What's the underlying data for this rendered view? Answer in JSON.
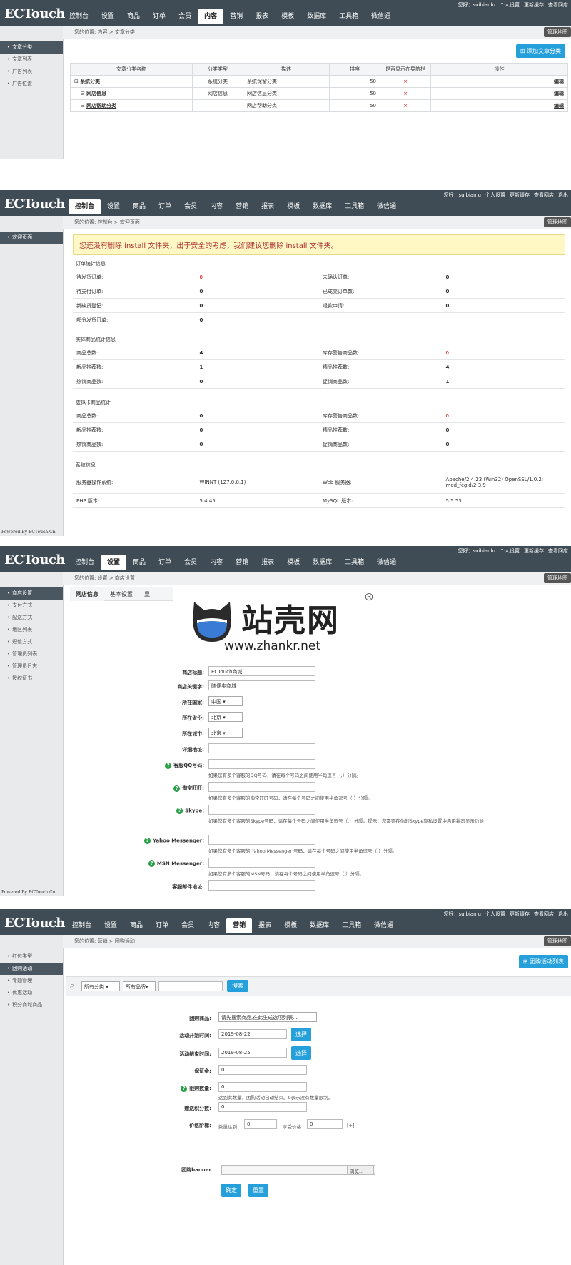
{
  "app": {
    "logo": "ECTouch",
    "user_links": [
      "您好：suibianlu",
      "个人设置",
      "更新缓存",
      "查看网店",
      "退出"
    ]
  },
  "nav": [
    "控制台",
    "设置",
    "商品",
    "订单",
    "会员",
    "内容",
    "营销",
    "报表",
    "模板",
    "数据库",
    "工具箱",
    "微信通"
  ],
  "mgmt_label": "管理地图",
  "powered": "Powered By ECTouch.Cn",
  "watermark": {
    "brand": "站壳网",
    "registered": "®",
    "url": "www.zhankr.net"
  },
  "panel1": {
    "active_nav": "内容",
    "crumb": "您的位置: 内容 > 文章分类",
    "sidebar": [
      "文章分类",
      "文章列表",
      "广告列表",
      "广告位置"
    ],
    "add_button": "添加文章分类",
    "headers": [
      "文章分类名称",
      "分类类型",
      "描述",
      "排序",
      "是否显示在导航栏",
      "操作"
    ],
    "rows": [
      {
        "name": "系统分类",
        "type": "系统分类",
        "desc": "系统保留分类",
        "order": "50",
        "nav": "×",
        "op": "编辑"
      },
      {
        "name": "网店信息",
        "type": "网店信息",
        "desc": "网店信息分类",
        "order": "50",
        "nav": "×",
        "op": "编辑"
      },
      {
        "name": "网店帮助分类",
        "type": "",
        "desc": "网店帮助分类",
        "order": "50",
        "nav": "×",
        "op": "编辑"
      }
    ]
  },
  "panel2": {
    "active_nav": "控制台",
    "crumb": "您的位置: 控制台 > 欢迎页面",
    "sidebar": [
      "欢迎页面"
    ],
    "warning": "您还没有删除 install 文件夹，出于安全的考虑，我们建议您删除 install 文件夹。",
    "sections": [
      {
        "title": "订单统计信息",
        "rows": [
          [
            "待发货订单:",
            "0",
            "未确认订单:",
            "0"
          ],
          [
            "待支付订单:",
            "0",
            "已成交订单数:",
            "0"
          ],
          [
            "新缺货登记:",
            "0",
            "退款申请:",
            "0"
          ],
          [
            "部分发货订单:",
            "0",
            "",
            ""
          ]
        ]
      },
      {
        "title": "实体商品统计信息",
        "rows": [
          [
            "商品总数:",
            "4",
            "库存警告商品数:",
            "0"
          ],
          [
            "新品推荐数:",
            "1",
            "精品推荐数:",
            "4"
          ],
          [
            "热销商品数:",
            "0",
            "促销商品数:",
            "1"
          ]
        ]
      },
      {
        "title": "虚拟卡商品统计",
        "rows": [
          [
            "商品总数:",
            "0",
            "库存警告商品数:",
            "0"
          ],
          [
            "新品推荐数:",
            "0",
            "精品推荐数:",
            "0"
          ],
          [
            "热销商品数:",
            "0",
            "促销商品数:",
            "0"
          ]
        ]
      },
      {
        "title": "系统信息",
        "rows": [
          [
            "服务器操作系统:",
            "WINNT (127.0.0.1)",
            "Web 服务器:",
            "Apache/2.4.23 (Win32) OpenSSL/1.0.2j mod_fcgid/2.3.9"
          ],
          [
            "PHP 版本:",
            "5.4.45",
            "MySQL 版本:",
            "5.5.53"
          ]
        ]
      }
    ]
  },
  "panel3": {
    "active_nav": "设置",
    "crumb": "您的位置: 设置 > 商店设置",
    "sidebar": [
      "商店设置",
      "支付方式",
      "配送方式",
      "地区列表",
      "短信方式",
      "管理员列表",
      "管理员日志",
      "授权证书"
    ],
    "tabs": [
      "网店信息",
      "基本设置",
      "显"
    ],
    "fields": [
      {
        "label": "商店标题:",
        "value": "ECTouch商城"
      },
      {
        "label": "商店关键字:",
        "value": "随便卖商城"
      },
      {
        "label": "所在国家:",
        "value": "中国"
      },
      {
        "label": "所在省份:",
        "value": "北京"
      },
      {
        "label": "所在城市:",
        "value": "北京"
      },
      {
        "label": "详细地址:",
        "value": ""
      },
      {
        "label": "客服QQ号码:",
        "value": "",
        "hint": "如果您有多个客服的QQ号码，请在每个号码之间使用半角逗号（,）分隔。"
      },
      {
        "label": "淘宝旺旺:",
        "value": "",
        "hint": "如果您有多个客服的淘宝旺旺号码，请在每个号码之间使用半角逗号（,）分隔。"
      },
      {
        "label": "Skype:",
        "value": "",
        "hint": "如果您有多个客服的Skype号码，请在每个号码之间使用半角逗号（,）分隔。提示：您需要在你的Skype隐私设置中启用状态显示功能"
      },
      {
        "label": "Yahoo Messenger:",
        "value": "",
        "hint": "如果您有多个客服的 Yahoo Messenger 号码，请在每个号码之间使用半角逗号（,）分隔。"
      },
      {
        "label": "MSN Messenger:",
        "value": "",
        "hint": "如果您有多个客服的MSN号码，请在每个号码之间使用半角逗号（,）分隔。"
      },
      {
        "label": "客服邮件地址:",
        "value": ""
      }
    ]
  },
  "panel4": {
    "active_nav": "营销",
    "crumb": "您的位置: 营销 > 团购活动",
    "sidebar": [
      "红包类型",
      "团购活动",
      "专题管理",
      "优惠活动",
      "积分商城商品"
    ],
    "list_button": "团购活动列表",
    "search": {
      "cat": "所有分类",
      "brand": "所有品牌",
      "button": "搜索"
    },
    "goods_label": "团购商品:",
    "goods_select": "请先搜索商品,在此生成选项列表...",
    "start_label": "活动开始时间:",
    "start_value": "2019-08-22",
    "end_label": "活动结束时间:",
    "end_value": "2019-08-25",
    "choose": "选择",
    "deposit_label": "保证金:",
    "deposit_value": "0",
    "limit_label": "限购数量:",
    "limit_value": "0",
    "limit_hint": "达到此数量，团购活动自动结束。0表示没有数量限制。",
    "points_label": "赠送积分数:",
    "points_value": "0",
    "price_label": "价格阶梯:",
    "qty_label": "数量达到",
    "qty_value": "0",
    "price_label2": "享受价格",
    "price_value": "0",
    "add": "[+]",
    "banner_label": "团购banner",
    "browse": "浏览...",
    "submit": "确定",
    "reset": "重置"
  }
}
